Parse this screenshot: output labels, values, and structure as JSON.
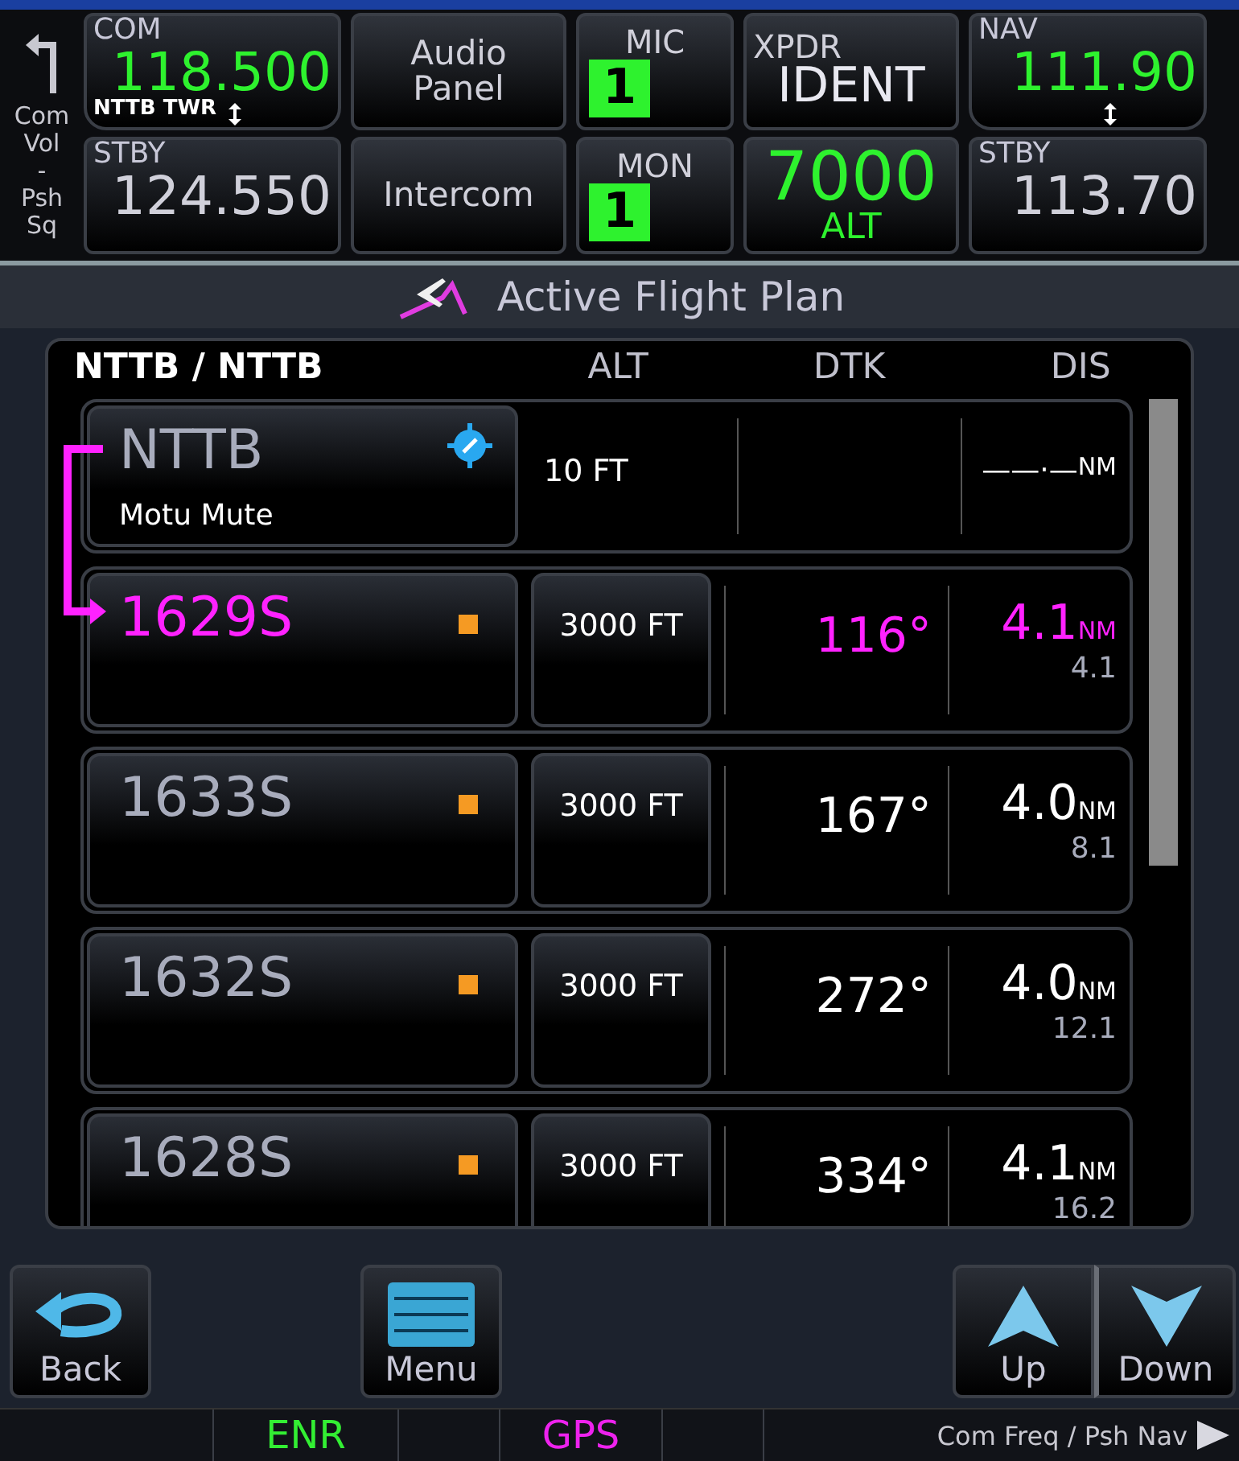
{
  "side_label": [
    "Com",
    "Vol",
    "-",
    "Psh",
    "Sq"
  ],
  "com": {
    "label": "COM",
    "active": "118.500",
    "station": "NTTB TWR",
    "standby_label": "STBY",
    "standby": "124.550"
  },
  "audio": {
    "top": "Audio Panel",
    "bottom": "Intercom"
  },
  "mic": {
    "label": "MIC",
    "value": "1"
  },
  "mon": {
    "label": "MON",
    "value": "1"
  },
  "xpdr": {
    "label": "XPDR",
    "mode": "IDENT",
    "code": "7000",
    "status": "ALT"
  },
  "nav": {
    "label": "NAV",
    "active": "111.90",
    "standby_label": "STBY",
    "standby": "113.70"
  },
  "title": "Active Flight Plan",
  "flight_plan": {
    "header": "NTTB / NTTB",
    "columns": [
      "ALT",
      "DTK",
      "DIS"
    ],
    "rows": [
      {
        "kind": "airport",
        "ident": "NTTB",
        "name": "Motu Mute",
        "alt": "10 FT",
        "alt_button": false,
        "dis": "——·—",
        "unit": "NM",
        "active": false
      },
      {
        "kind": "waypoint",
        "ident": "1629S",
        "alt": "3000 FT",
        "alt_button": true,
        "dtk": "116°",
        "dis": "4.1",
        "unit": "NM",
        "total": "4.1",
        "active": true
      },
      {
        "kind": "waypoint",
        "ident": "1633S",
        "alt": "3000 FT",
        "alt_button": true,
        "dtk": "167°",
        "dis": "4.0",
        "unit": "NM",
        "total": "8.1",
        "active": false
      },
      {
        "kind": "waypoint",
        "ident": "1632S",
        "alt": "3000 FT",
        "alt_button": true,
        "dtk": "272°",
        "dis": "4.0",
        "unit": "NM",
        "total": "12.1",
        "active": false
      },
      {
        "kind": "waypoint",
        "ident": "1628S",
        "alt": "3000 FT",
        "alt_button": true,
        "dtk": "334°",
        "dis": "4.1",
        "unit": "NM",
        "total": "16.2",
        "active": false
      }
    ]
  },
  "buttons": [
    {
      "kind": "back",
      "label": "Back"
    },
    {
      "kind": "menu",
      "label": "Menu"
    },
    {
      "kind": "up",
      "label": "Up"
    },
    {
      "kind": "down",
      "label": "Down"
    }
  ],
  "status_bar": [
    {
      "kind": "phase",
      "text": "ENR"
    },
    {
      "kind": "source",
      "text": "GPS"
    }
  ],
  "hint": "Com Freq / Psh Nav"
}
